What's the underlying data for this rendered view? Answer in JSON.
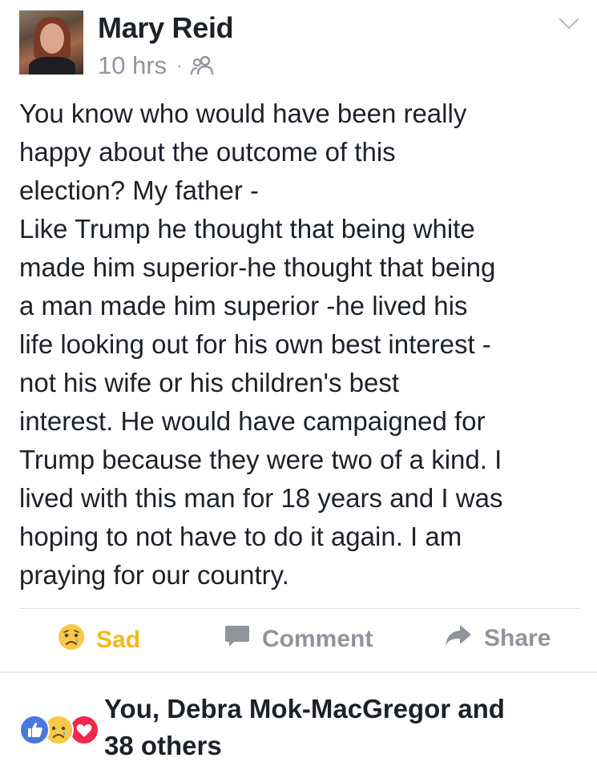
{
  "post": {
    "author": "Mary Reid",
    "time": "10 hrs",
    "separator": "·",
    "audience_icon": "friends-icon",
    "menu_icon": "chevron-down-icon",
    "text_lines": [
      "You know who would have been really",
      "happy about the outcome of this",
      "election? My father -",
      "Like Trump he thought that being white",
      "made him superior-he thought that being",
      "a man made him superior -he lived his",
      "life looking out for his own best interest -",
      "not his wife or his children's best",
      "interest. He would have campaigned for",
      "Trump because they were two of a kind. I",
      "lived with this man for 18 years and I was",
      "hoping to not have to do it again. I am",
      "praying for our country."
    ]
  },
  "actions": {
    "sad_label": "Sad",
    "comment_label": "Comment",
    "share_label": "Share",
    "sad_color": "#f0ba15",
    "muted_color": "#90949c"
  },
  "reactions": {
    "icons": [
      "like-icon",
      "sad-icon",
      "love-icon"
    ],
    "summary_line1": "You, Debra Mok-MacGregor and",
    "summary_line2": "38 others"
  }
}
